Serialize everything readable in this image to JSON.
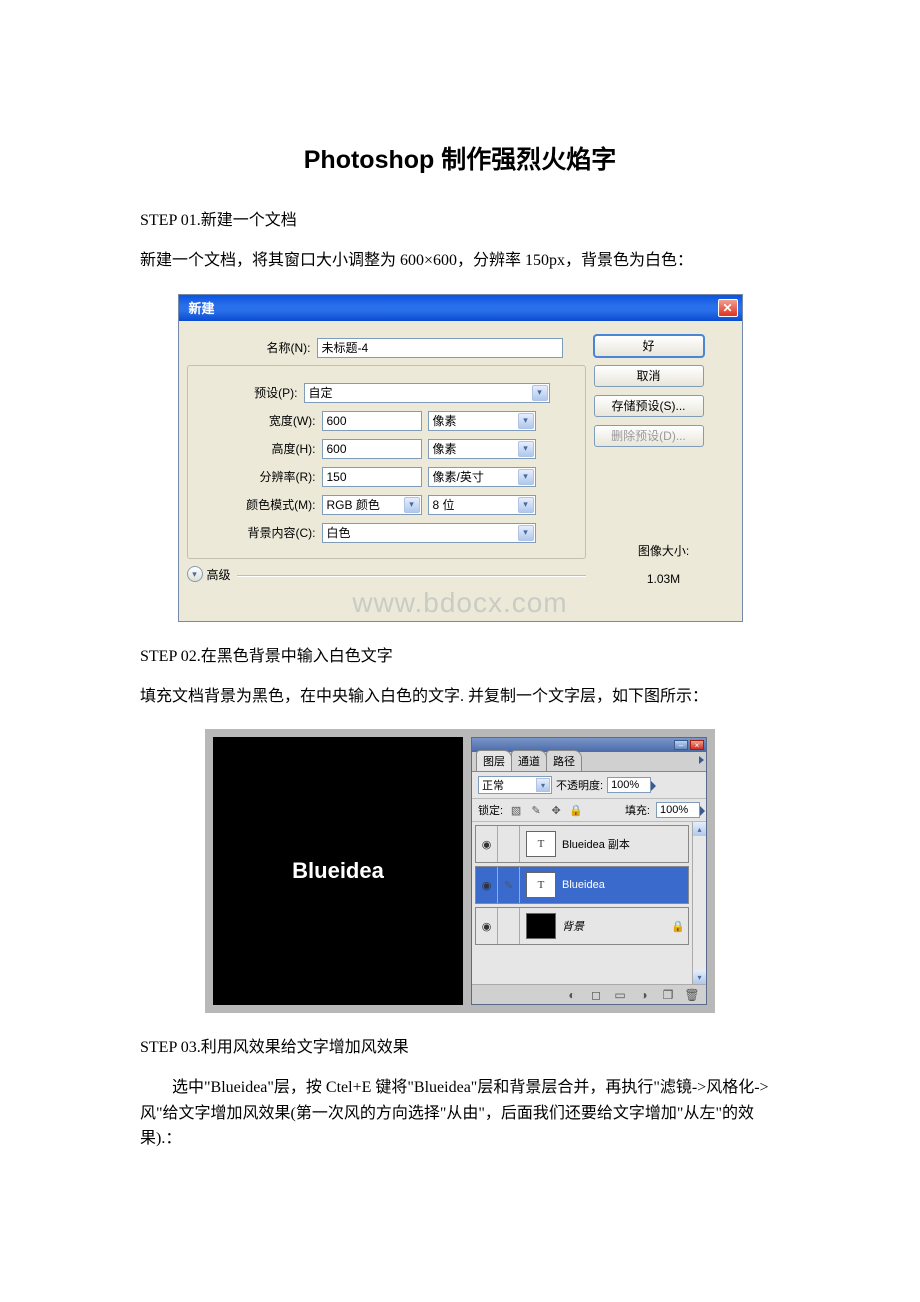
{
  "title": "Photoshop 制作强烈火焰字",
  "step1": {
    "heading": "STEP 01.新建一个文档",
    "desc": "新建一个文档，将其窗口大小调整为 600×600，分辨率 150px，背景色为白色："
  },
  "dialog": {
    "title": "新建",
    "close": "✕",
    "name_label": "名称(N):",
    "name_value": "未标题-4",
    "preset_label": "预设(P):",
    "preset_value": "自定",
    "width_label": "宽度(W):",
    "width_value": "600",
    "width_unit": "像素",
    "height_label": "高度(H):",
    "height_value": "600",
    "height_unit": "像素",
    "res_label": "分辨率(R):",
    "res_value": "150",
    "res_unit": "像素/英寸",
    "mode_label": "颜色模式(M):",
    "mode_value": "RGB 颜色",
    "depth_value": "8 位",
    "bg_label": "背景内容(C):",
    "bg_value": "白色",
    "advanced": "高级",
    "btn_ok": "好",
    "btn_cancel": "取消",
    "btn_save_preset": "存储预设(S)...",
    "btn_del_preset": "删除预设(D)...",
    "size_caption": "图像大小:",
    "size_value": "1.03M",
    "watermark": "www.bdocx.com"
  },
  "step2": {
    "heading": "STEP 02.在黑色背景中输入白色文字",
    "desc": "填充文档背景为黑色，在中央输入白色的文字. 并复制一个文字层，如下图所示："
  },
  "canvas_text": "Blueidea",
  "layers": {
    "tab_layers": "图层",
    "tab_channels": "通道",
    "tab_paths": "路径",
    "blend": "正常",
    "opacity_label": "不透明度:",
    "opacity_value": "100%",
    "lock_label": "锁定:",
    "fill_label": "填充:",
    "fill_value": "100%",
    "items": [
      {
        "name": "Blueidea 副本",
        "thumb": "T",
        "selected": false,
        "linked": false
      },
      {
        "name": "Blueidea",
        "thumb": "T",
        "selected": true,
        "linked": true
      },
      {
        "name": "背景",
        "thumb": "bg",
        "selected": false,
        "locked": true
      }
    ]
  },
  "step3": {
    "heading": "STEP 03.利用风效果给文字增加风效果",
    "desc": "选中\"Blueidea\"层，按 Ctel+E 键将\"Blueidea\"层和背景层合并，再执行\"滤镜->风格化->风\"给文字增加风效果(第一次风的方向选择\"从由\"，后面我们还要给文字增加\"从左\"的效果).："
  }
}
